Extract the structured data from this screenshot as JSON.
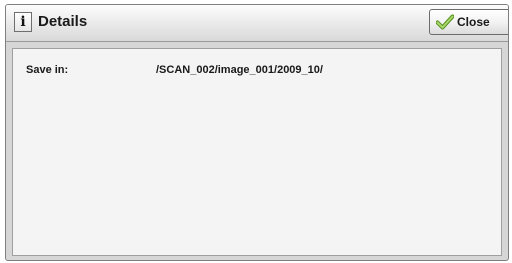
{
  "dialog": {
    "title": "Details",
    "info_icon_glyph": "i",
    "close_label": "Close",
    "close_icon": "checkmark-icon"
  },
  "details": {
    "save_in_label": "Save in:",
    "save_in_value": "/SCAN_002/image_001/2009_10/"
  },
  "colors": {
    "checkmark": "#8bc34a",
    "background": "#d6d6d6",
    "panel": "#f4f4f4"
  }
}
